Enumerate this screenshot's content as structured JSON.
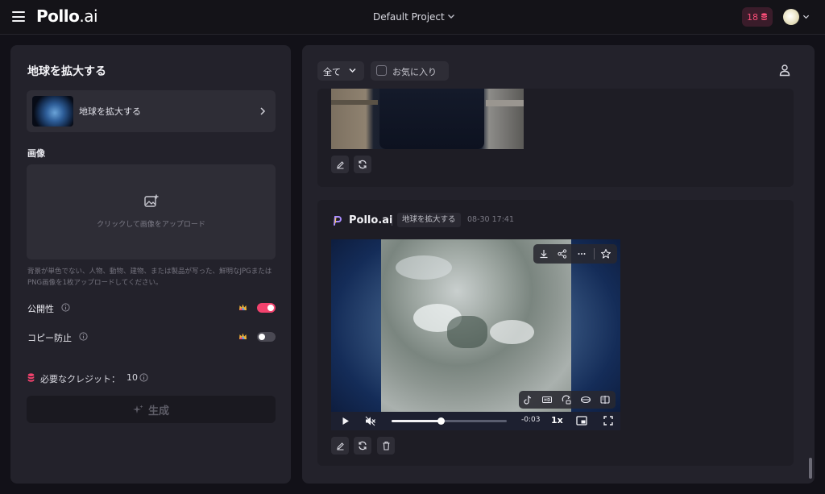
{
  "header": {
    "logo_main": "Pollo",
    "logo_suffix": ".ai",
    "project_name": "Default Project",
    "credits_count": "18"
  },
  "left_panel": {
    "title": "地球を拡大する",
    "template_name": "地球を拡大する",
    "image_label": "画像",
    "upload_text": "クリックして画像をアップロード",
    "upload_hint": "背景が単色でない、人物、動物、建物、または製品が写った、鮮明なJPGまたはPNG画像を1枚アップロードしてください。",
    "public_label": "公開性",
    "public_enabled": true,
    "copy_protect_label": "コピー防止",
    "copy_protect_enabled": false,
    "credits_label": "必要なクレジット：",
    "credits_value": "10",
    "generate_label": "生成"
  },
  "right_panel": {
    "filter_all": "全て",
    "favorites": "お気に入り",
    "result": {
      "brand": "Pollo.ai",
      "task": "地球を拡大する",
      "timestamp": "08-30 17:41",
      "video": {
        "time_remaining": "-0:03",
        "speed": "1x",
        "progress": 0.43
      }
    }
  },
  "colors": {
    "accent": "#f2426d",
    "panel": "#23222b",
    "background": "#121118"
  }
}
